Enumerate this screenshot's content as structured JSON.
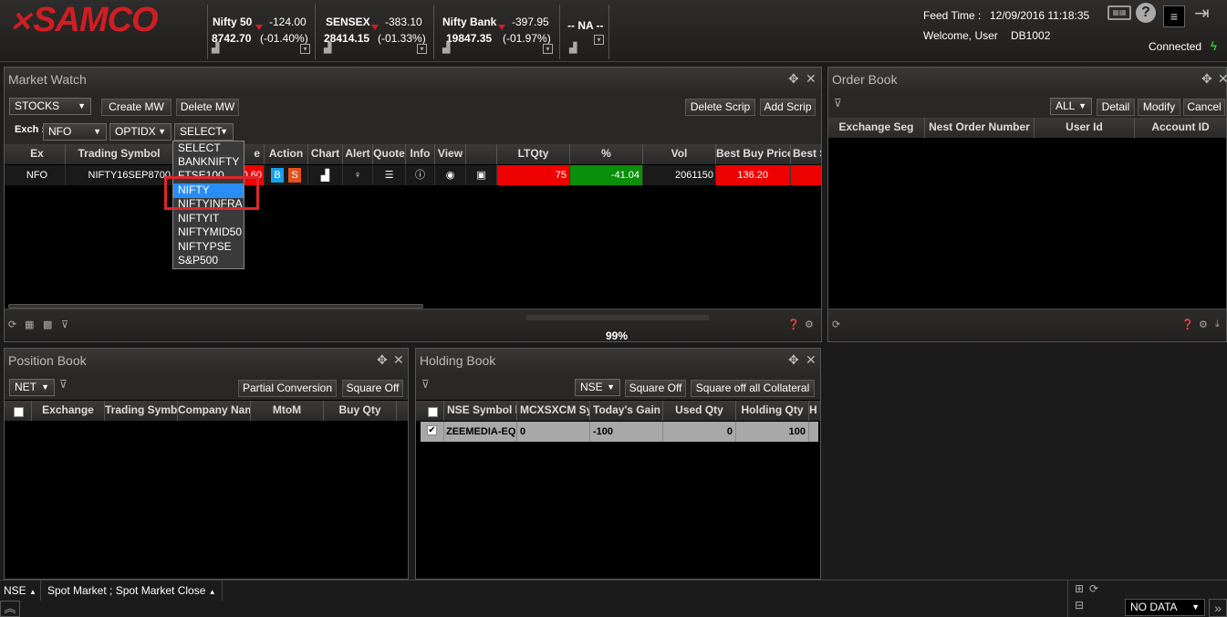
{
  "header": {
    "logo": "SAMCO",
    "indices": [
      {
        "name": "Nifty 50",
        "change": "-124.00",
        "value": "8742.70",
        "pct": "(-01.40%)"
      },
      {
        "name": "SENSEX",
        "change": "-383.10",
        "value": "28414.15",
        "pct": "(-01.33%)"
      },
      {
        "name": "Nifty Bank",
        "change": "-397.95",
        "value": "19847.35",
        "pct": "(-01.97%)"
      },
      {
        "name": "-- NA --",
        "change": "",
        "value": "",
        "pct": ""
      }
    ],
    "feed_label": "Feed Time :",
    "feed_time": "12/09/2016 11:18:35",
    "welcome": "Welcome, User",
    "user_id": "DB1002",
    "status": "Connected"
  },
  "market_watch": {
    "title": "Market Watch",
    "watchlist": "STOCKS",
    "create_label": "Create MW",
    "delete_label": "Delete MW",
    "delete_scrip_label": "Delete Scrip",
    "add_scrip_label": "Add Scrip",
    "exch_label": "Exch :",
    "exchange": "NFO",
    "instrument": "OPTIDX",
    "symbol_select": "SELECT",
    "columns": [
      "Ex",
      "Trading Symbol",
      "e",
      "Action",
      "Chart",
      "Alert",
      "Quote",
      "Info",
      "View",
      "",
      "LTQty",
      "%",
      "Vol",
      "Best Buy Price",
      "Best S"
    ],
    "row": {
      "ex": "NFO",
      "symbol": "NIFTY16SEP8700",
      "ltp": "0.60",
      "buy": "B",
      "sell": "S",
      "ltqty": "75",
      "pct": "-41.04",
      "vol": "2061150",
      "best_buy": "136.20"
    },
    "dropdown_options": [
      "SELECT",
      "BANKNIFTY",
      "FTSE100",
      "NIFTY",
      "NIFTYINFRA",
      "NIFTYIT",
      "NIFTYMID50",
      "NIFTYPSE",
      "S&P500"
    ],
    "dropdown_selected": "NIFTY",
    "progress": "99%"
  },
  "order_book": {
    "title": "Order Book",
    "filter": "ALL",
    "detail_label": "Detail",
    "modify_label": "Modify",
    "cancel_label": "Cancel",
    "columns": [
      "Exchange Seg",
      "Nest Order Number",
      "User Id",
      "Account ID"
    ]
  },
  "position_book": {
    "title": "Position Book",
    "filter": "NET",
    "partial_label": "Partial Conversion",
    "square_off_label": "Square Off",
    "columns": [
      "Exchange",
      "Trading Symbol",
      "Company Name",
      "MtoM",
      "Buy Qty"
    ]
  },
  "holding_book": {
    "title": "Holding Book",
    "exchange": "NSE",
    "square_off_label": "Square Off",
    "square_all_label": "Square off all Collateral",
    "columns": [
      "NSE Symbol I",
      "MCXSXCM Sy",
      "Today's Gain",
      "Used Qty",
      "Holding Qty",
      "H"
    ],
    "row": {
      "symbol": "ZEEMEDIA-EQ",
      "mcx": "0",
      "gain": "-100",
      "used": "0",
      "holding": "100"
    }
  },
  "statusbar": {
    "exchange": "NSE",
    "market": "Spot Market ; Spot Market Close",
    "data": "NO DATA"
  }
}
